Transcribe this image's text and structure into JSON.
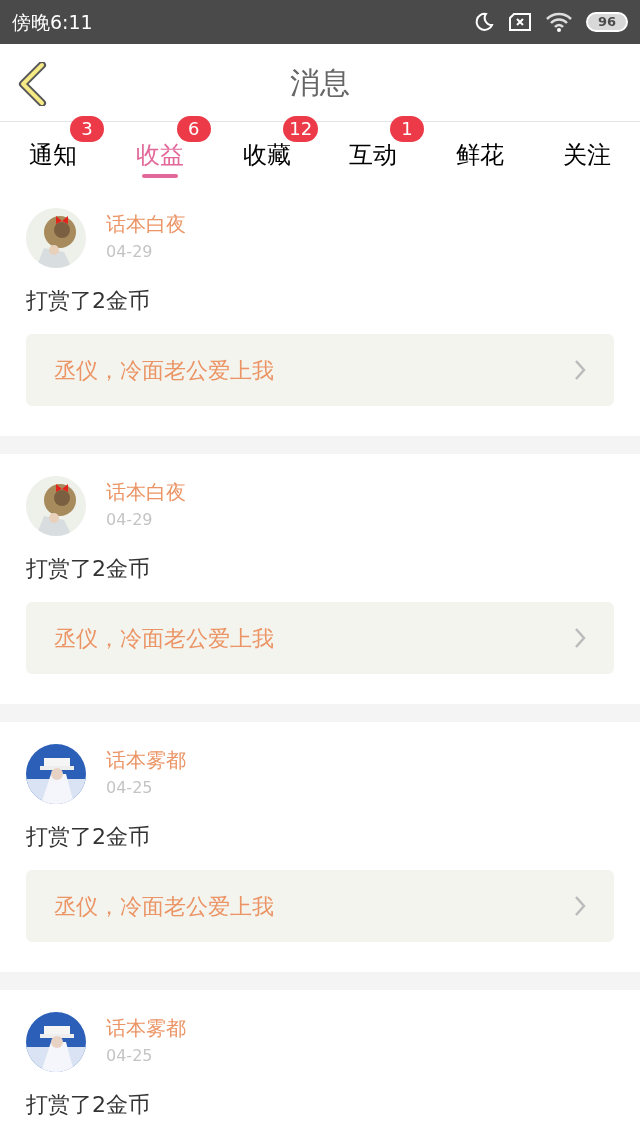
{
  "status_bar": {
    "time": "傍晚6:11",
    "battery": "96"
  },
  "header": {
    "title": "消息"
  },
  "tabs": [
    {
      "label": "通知",
      "badge": "3",
      "selected": false
    },
    {
      "label": "收益",
      "badge": "6",
      "selected": true
    },
    {
      "label": "收藏",
      "badge": "12",
      "selected": false
    },
    {
      "label": "互动",
      "badge": "1",
      "selected": false
    },
    {
      "label": "鲜花",
      "selected": false
    },
    {
      "label": "关注",
      "selected": false
    }
  ],
  "messages": [
    {
      "user": "话本白夜",
      "date": "04-29",
      "text": "打赏了2金币",
      "book": "丞仪，冷面老公爱上我"
    },
    {
      "user": "话本白夜",
      "date": "04-29",
      "text": "打赏了2金币",
      "book": "丞仪，冷面老公爱上我"
    },
    {
      "user": "话本雾都",
      "date": "04-25",
      "text": "打赏了2金币",
      "book": "丞仪，冷面老公爱上我"
    },
    {
      "user": "话本雾都",
      "date": "04-25",
      "text": "打赏了2金币"
    }
  ]
}
